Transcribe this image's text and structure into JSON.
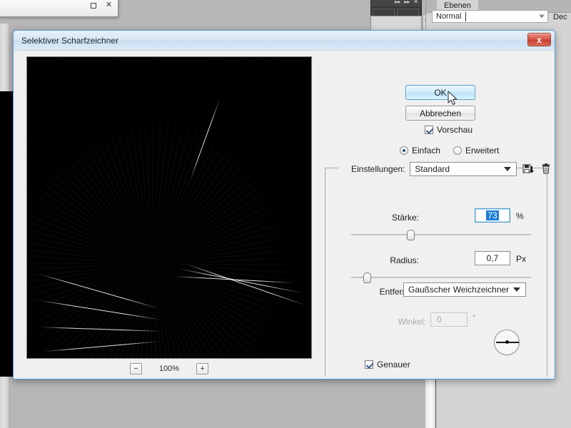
{
  "background": {
    "doc_window": {
      "restore_icon": "restore-icon",
      "close_icon": "close-icon"
    },
    "panel": {
      "tab_label": "Ebenen",
      "blend_mode_value": "Normal",
      "opacity_label": "Dec"
    }
  },
  "dialog": {
    "title": "Selektiver Scharfzeichner",
    "close_label": "x",
    "buttons": {
      "ok": "OK",
      "cancel": "Abbrechen"
    },
    "preview_checkbox": {
      "label": "Vorschau",
      "checked": true
    },
    "mode": {
      "simple_label": "Einfach",
      "advanced_label": "Erweitert",
      "selected": "Einfach"
    },
    "settings": {
      "label": "Einstellungen:",
      "value": "Standard",
      "save_icon": "save-preset-icon",
      "delete_icon": "delete-preset-icon"
    },
    "strength": {
      "label": "Stärke:",
      "value": "73",
      "unit": "%",
      "slider_percent": 33
    },
    "radius": {
      "label": "Radius:",
      "value": "0,7",
      "unit": "Px",
      "slider_percent": 7
    },
    "remove": {
      "label": "Entfernen:",
      "value": "Gaußscher Weichzeichner"
    },
    "angle": {
      "label": "Winkel:",
      "value": "0",
      "unit": "°",
      "disabled": true,
      "dial_icon": "angle-dial-icon"
    },
    "accurate_checkbox": {
      "label": "Genauer",
      "checked": true
    },
    "zoom": {
      "minus": "−",
      "level": "100%",
      "plus": "+"
    },
    "preview_image": "kitten-preview-image"
  }
}
